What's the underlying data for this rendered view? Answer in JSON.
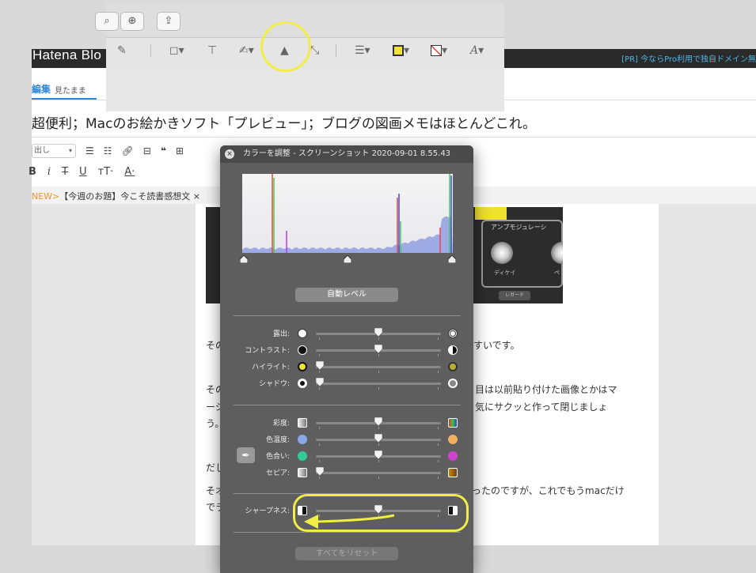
{
  "hatena": {
    "logo": "Hatena Blo",
    "promo": "[PR] 今ならPro利用で独自ドメイン無",
    "tab_edit": "編集",
    "tab_view": "見たまま",
    "post_title": "超便利；Macのお絵かきソフト「プレビュー」；ブログの図画メモはほとんどこれ。",
    "heading_select": "出し",
    "news_tag": "NEW>",
    "news_text": "【今週のお題】今こそ読書感想文",
    "news_close": "×"
  },
  "image": {
    "panel_label": "アンプモジュレーシ",
    "knob1": "ディケイ",
    "knob2": "ペ",
    "button": "レガード"
  },
  "body_text": {
    "p1_left": "その",
    "p1_right": "すいです。",
    "p2_left": "その",
    "p2_right": "目は以前貼り付けた画像とかはマ",
    "p3_left": "ーシ",
    "p3_right": "気にサクッと作って閉じましょ",
    "p4_left": "う。",
    "p5_left": "だし",
    "p6_left": "そオ",
    "p6_right": "ったのですが、これでもうmacだけ",
    "p7_left": "でラ"
  },
  "preview_toolbar": {
    "zoom_icon": "zoom-in-icon",
    "share_icon": "share-icon"
  },
  "dialog": {
    "title": "カラーを調整 - スクリーンショット 2020-09-01 8.55.43",
    "auto_levels": "自動レベル",
    "reset_all": "すべてをリセット",
    "sliders_group1": [
      {
        "label": "露出:",
        "value": 0.5
      },
      {
        "label": "コントラスト:",
        "value": 0.5
      },
      {
        "label": "ハイライト:",
        "value": 0.0
      },
      {
        "label": "シャドウ:",
        "value": 0.0
      }
    ],
    "sliders_group2": [
      {
        "label": "彩度:",
        "value": 0.5
      },
      {
        "label": "色温度:",
        "value": 0.5
      },
      {
        "label": "色合い:",
        "value": 0.5
      },
      {
        "label": "セピア:",
        "value": 0.0
      }
    ],
    "sharpness": {
      "label": "シャープネス:",
      "value": 0.5
    }
  },
  "colors": {
    "highlight_yellow": "#f0ee44",
    "dialog_bg": "#5e5e5e",
    "hatena_blue": "#2b88d8"
  }
}
